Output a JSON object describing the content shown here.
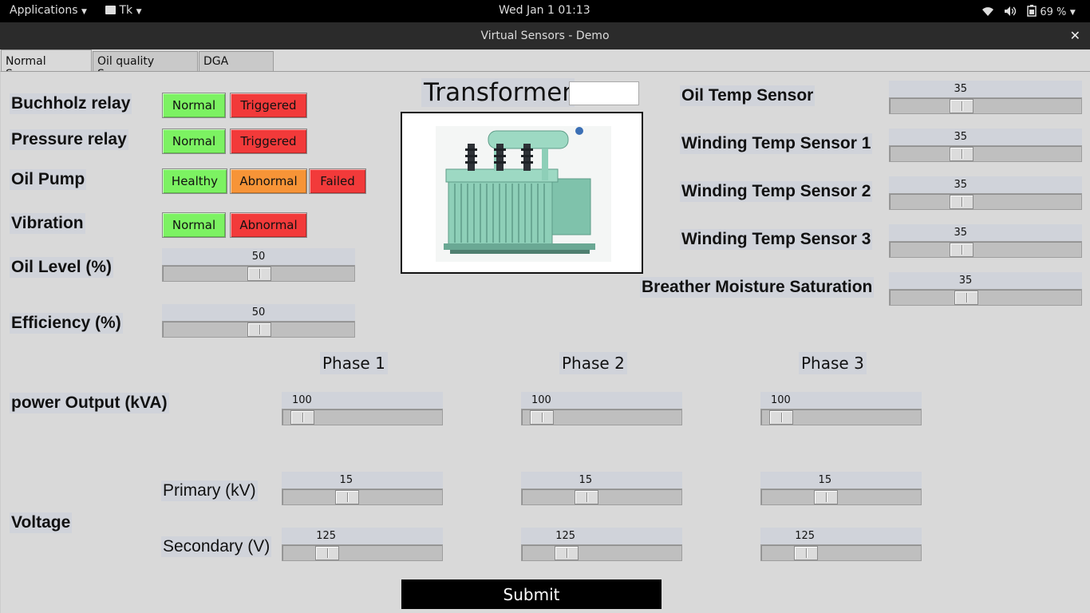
{
  "topbar": {
    "applications": "Applications",
    "app_name": "Tk",
    "clock": "Wed Jan 1  01:13",
    "battery": "69 %"
  },
  "window": {
    "title": "Virtual Sensors - Demo",
    "close": "✕"
  },
  "tabs": [
    "Normal Sensors",
    "Oil quality Sensors",
    "DGA sensors"
  ],
  "left": {
    "buchholz": {
      "label": "Buchholz relay",
      "buttons": [
        "Normal",
        "Triggered"
      ]
    },
    "pressure": {
      "label": "Pressure relay",
      "buttons": [
        "Normal",
        "Triggered"
      ]
    },
    "oil_pump": {
      "label": "Oil Pump",
      "buttons": [
        "Healthy",
        "Abnormal",
        "Failed"
      ]
    },
    "vibration": {
      "label": "Vibration",
      "buttons": [
        "Normal",
        "Abnormal"
      ]
    },
    "oil_level": {
      "label": "Oil Level (%)",
      "value": "50",
      "fraction": 0.5
    },
    "efficiency": {
      "label": "Efficiency (%)",
      "value": "50",
      "fraction": 0.5
    }
  },
  "center": {
    "title": "Transformer",
    "entry_value": ""
  },
  "right": [
    {
      "label": "Oil Temp Sensor",
      "value": "35",
      "fraction": 0.35
    },
    {
      "label": "Winding Temp Sensor 1",
      "value": "35",
      "fraction": 0.35
    },
    {
      "label": "Winding Temp Sensor 2",
      "value": "35",
      "fraction": 0.35
    },
    {
      "label": "Winding Temp Sensor 3",
      "value": "35",
      "fraction": 0.35
    },
    {
      "label": "Breather Moisture Saturation",
      "value": "35",
      "fraction": 0.38
    }
  ],
  "phases": [
    "Phase 1",
    "Phase 2",
    "Phase 3"
  ],
  "power": {
    "label": "power Output (kVA)",
    "values": [
      "100",
      "100",
      "100"
    ],
    "fraction": 0.05
  },
  "voltage": {
    "label": "Voltage",
    "primary": {
      "label": "Primary (kV)",
      "values": [
        "15",
        "15",
        "15"
      ],
      "fraction": 0.38
    },
    "secondary": {
      "label": "Secondary (V)",
      "values": [
        "125",
        "125",
        "125"
      ],
      "fraction": 0.23
    }
  },
  "submit": "Submit",
  "colors": {
    "green": "#7cf262",
    "red": "#f23a3a",
    "orange": "#f79437"
  }
}
